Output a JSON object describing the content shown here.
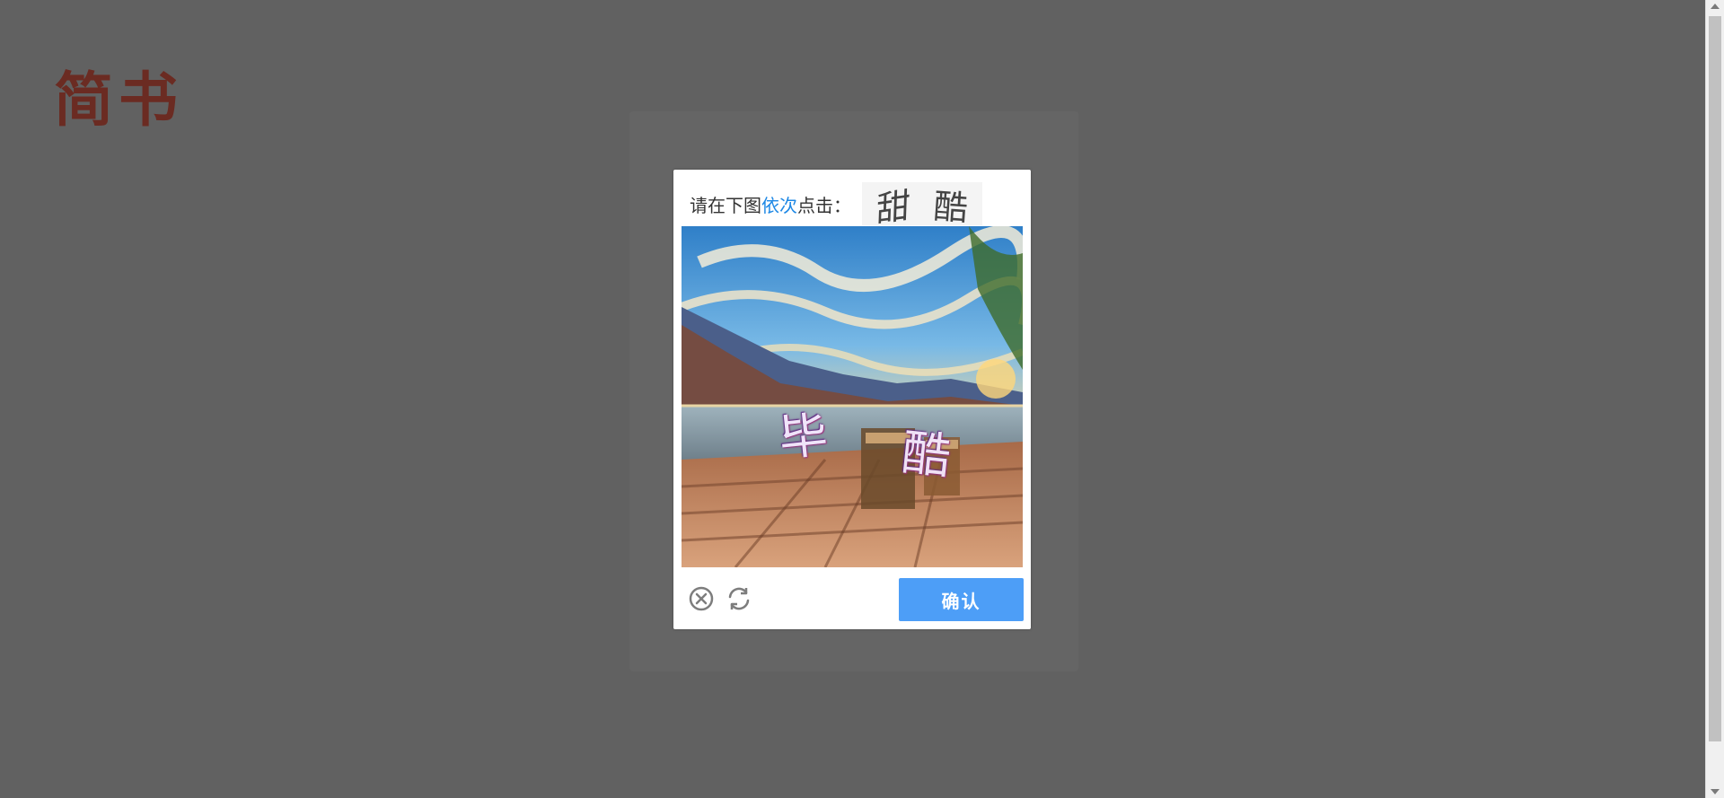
{
  "logo": {
    "text": "简书",
    "color": "#6b2b22"
  },
  "captcha": {
    "instruction_prefix": "请在下图",
    "instruction_highlight": "依次",
    "instruction_suffix": "点击：",
    "target_chars": [
      "甜",
      "酷"
    ],
    "image_chars": [
      "毕",
      "酷"
    ],
    "close_icon": "close-circle-icon",
    "refresh_icon": "refresh-icon",
    "confirm_label": "确认",
    "accent_color": "#1e88e5",
    "button_color": "#4d9ef7"
  },
  "scrollbar": {
    "visible": true
  }
}
